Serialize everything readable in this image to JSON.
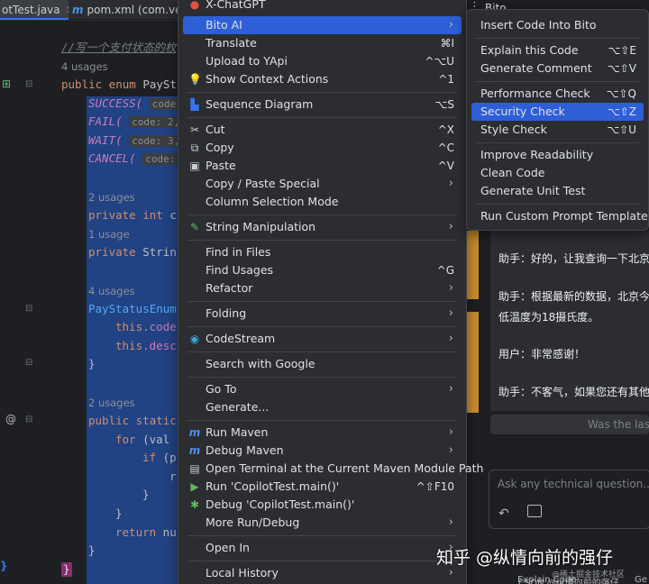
{
  "tabs": [
    {
      "label": "otTest.java"
    },
    {
      "label": "pom.xml (com.veez"
    }
  ],
  "editor": {
    "comment": "//写一个支付状态的枚",
    "usages_4": "4 usages",
    "enum_decl_kw": "public enum",
    "enum_decl_name": "PaySt",
    "consts": [
      {
        "name": "SUCCESS(",
        "hint": "code:"
      },
      {
        "name": "FAIL(",
        "hint": "code: 2,"
      },
      {
        "name": "WAIT(",
        "hint": "code: 3,"
      },
      {
        "name": "CANCEL(",
        "hint": "code:"
      }
    ],
    "usages_2a": "2 usages",
    "field1_kw": "private int",
    "field1_rest": " c",
    "usages_1": "1 usage",
    "field2_kw": "private",
    "field2_rest": " Strin",
    "usages_4b": "4 usages",
    "ctor": "PayStatusEnum",
    "this_code_kw": "this.",
    "this_code_f": "code",
    "this_desc_kw": "this.",
    "this_desc_f": "desc",
    "brace": "}",
    "usages_2b": "2 usages",
    "static_kw": "public static",
    "for_kw": "for",
    "for_rest": " (val",
    "if_kw": "if",
    "if_rest": " (p",
    "r": "r",
    "return_kw": "return",
    "return_rest": " nu"
  },
  "menu": {
    "items": [
      {
        "label": "X-ChatGPT",
        "shortcut": "",
        "arrow": false,
        "icon": "chatgpt-icon"
      },
      {
        "label": "Bito AI",
        "shortcut": "",
        "arrow": true,
        "highlight": true
      },
      {
        "label": "Translate",
        "shortcut": "⌘I"
      },
      {
        "label": "Upload to YApi",
        "shortcut": "^⌥U"
      },
      {
        "label": "Show Context Actions",
        "shortcut": "^1",
        "icon": "bulb-icon"
      },
      {
        "label": "Sequence Diagram",
        "shortcut": "⌥S",
        "icon": "sequence-diagram-icon"
      },
      {
        "label": "Cut",
        "shortcut": "^X",
        "icon": "scissors-icon"
      },
      {
        "label": "Copy",
        "shortcut": "^C",
        "icon": "copy-icon"
      },
      {
        "label": "Paste",
        "shortcut": "^V",
        "icon": "paste-icon"
      },
      {
        "label": "Copy / Paste Special",
        "shortcut": "",
        "arrow": true
      },
      {
        "label": "Column Selection Mode",
        "shortcut": ""
      },
      {
        "label": "String Manipulation",
        "shortcut": "",
        "arrow": true,
        "icon": "pencil-icon"
      },
      {
        "label": "Find in Files",
        "shortcut": ""
      },
      {
        "label": "Find Usages",
        "shortcut": "^G"
      },
      {
        "label": "Refactor",
        "shortcut": "",
        "arrow": true
      },
      {
        "label": "Folding",
        "shortcut": "",
        "arrow": true
      },
      {
        "label": "CodeStream",
        "shortcut": "",
        "arrow": true,
        "icon": "codestream-icon"
      },
      {
        "label": "Search with Google",
        "shortcut": ""
      },
      {
        "label": "Go To",
        "shortcut": "",
        "arrow": true
      },
      {
        "label": "Generate...",
        "shortcut": ""
      },
      {
        "label": "Run Maven",
        "shortcut": "",
        "arrow": true,
        "icon": "maven-run-icon"
      },
      {
        "label": "Debug Maven",
        "shortcut": "",
        "arrow": true,
        "icon": "maven-debug-icon"
      },
      {
        "label": "Open Terminal at the Current Maven Module Path",
        "shortcut": "",
        "icon": "terminal-icon"
      },
      {
        "label": "Run 'CopilotTest.main()'",
        "shortcut": "^⇧F10",
        "icon": "run-icon"
      },
      {
        "label": "Debug 'CopilotTest.main()'",
        "shortcut": "",
        "icon": "debug-icon"
      },
      {
        "label": "More Run/Debug",
        "shortcut": "",
        "arrow": true
      },
      {
        "label": "Open In",
        "shortcut": "",
        "arrow": true
      },
      {
        "label": "Local History",
        "shortcut": "",
        "arrow": true
      }
    ]
  },
  "submenu": {
    "items": [
      {
        "label": "Insert Code Into Bito",
        "shortcut": ""
      },
      {
        "label": "Explain this Code",
        "shortcut": "⌥⇧E"
      },
      {
        "label": "Generate Comment",
        "shortcut": "⌥⇧V"
      },
      {
        "label": "Performance Check",
        "shortcut": "⌥⇧Q"
      },
      {
        "label": "Security Check",
        "shortcut": "⌥⇧Z",
        "highlight": true
      },
      {
        "label": "Style Check",
        "shortcut": "⌥⇧U"
      },
      {
        "label": "Improve Readability",
        "shortcut": ""
      },
      {
        "label": "Clean Code",
        "shortcut": ""
      },
      {
        "label": "Generate Unit Test",
        "shortcut": ""
      },
      {
        "label": "Run Custom Prompt Template",
        "shortcut": ""
      }
    ]
  },
  "bito": {
    "title": "Bito",
    "chat": [
      "助手：好的，让我查询一下北京",
      "助手：根据最新的数据，北京今",
      "低温度为18摄氏度。",
      "用户：非常感谢！",
      "助手：不客气，如果您还有其他"
    ],
    "was_last": "Was the last",
    "input_placeholder": "Ask any technical question...",
    "bottom_label": "Explain Code",
    "bottom_label2": "Ge"
  },
  "watermark": {
    "main": "知乎 @纵情向前的强仔",
    "sub": "@稀土掘金技术社区",
    "csdn": "CSDN @纵情向前的强仔"
  }
}
